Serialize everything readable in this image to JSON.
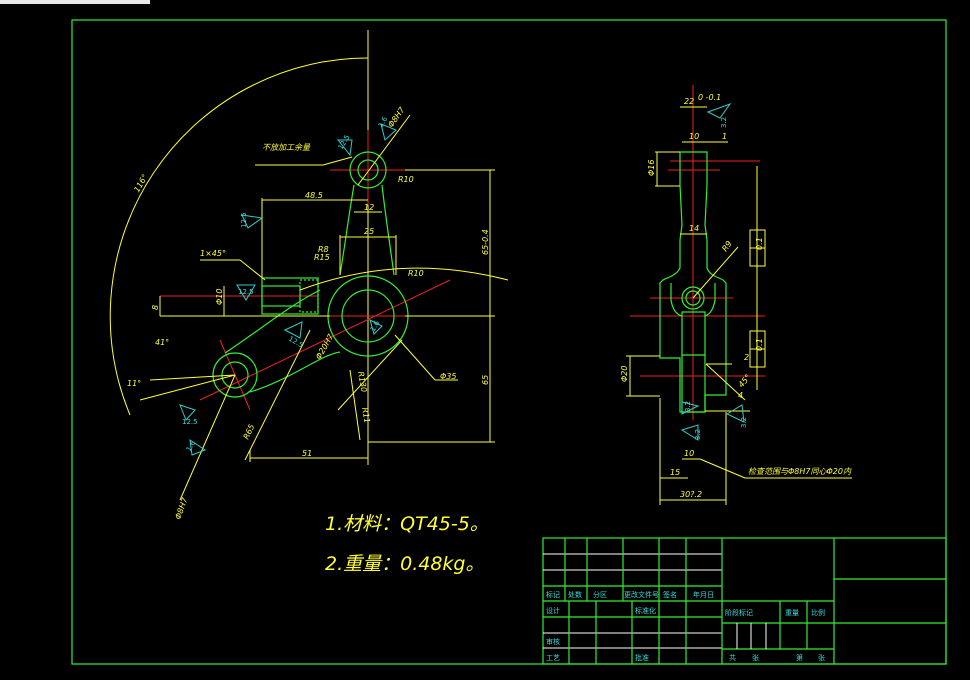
{
  "drawing": {
    "colors": {
      "background": "#000000",
      "frame": "#33ee33",
      "dimension": "#ffff33",
      "centerline": "#ee2222",
      "roughness": "#33cccc"
    },
    "notes": [
      "1.材料：QT45-5。",
      "2.重量：0.48kg。"
    ],
    "front_view": {
      "callouts": {
        "no_allowance": "不放加工余量",
        "chamfer": "1×45°"
      },
      "dims": {
        "arc_angle": "116°",
        "d48_5": "48.5",
        "d12": "12",
        "d25": "25",
        "r10_top": "R10",
        "r10_mid": "R10",
        "r8": "R8",
        "r15": "R15",
        "height_tol": "65-0.4",
        "d65": "65",
        "d8": "8",
        "phi10": "Φ10",
        "phi20": "Φ20H7",
        "phi35": "Φ35",
        "r130": "R130",
        "r11": "R11",
        "r65": "R65",
        "d51": "51",
        "a41": "41°",
        "a11": "11°",
        "phi8": "Φ8H7",
        "phi16": "Φ8H7"
      },
      "roughness": [
        "12.5",
        "1.6",
        "12.5",
        "12.5",
        "12.5",
        "1.6",
        "12.5",
        "1.6"
      ]
    },
    "side_view": {
      "dims": {
        "d22": "22",
        "tol22": "0 -0.1",
        "d10": "10",
        "d1": "1",
        "phi16": "Φ16",
        "d14": "14",
        "r9": "R9",
        "phi20": "Φ20",
        "d2": "2",
        "d4": "4",
        "d45": "45°",
        "d10b": "10",
        "d15": "15",
        "d30": "30?.2"
      },
      "tolerance_frames": [
        "0.1",
        "0.1"
      ],
      "roughness": [
        "3.2",
        "3.2",
        "3.2",
        "3.2"
      ],
      "callout": "检查范围与Φ8H7同心Φ20内"
    },
    "title_block": {
      "header_row": [
        "标记",
        "处数",
        "分区",
        "更改文件号",
        "签名",
        "年月日"
      ],
      "design": "设计",
      "standardize": "标准化",
      "review": "审核",
      "process": "工艺",
      "approve": "批准",
      "stage_mark": "阶段标记",
      "weight": "重量",
      "scale": "比例",
      "total": "共",
      "sheets": "张",
      "sheet_no": "第",
      "sheets2": "张"
    }
  }
}
